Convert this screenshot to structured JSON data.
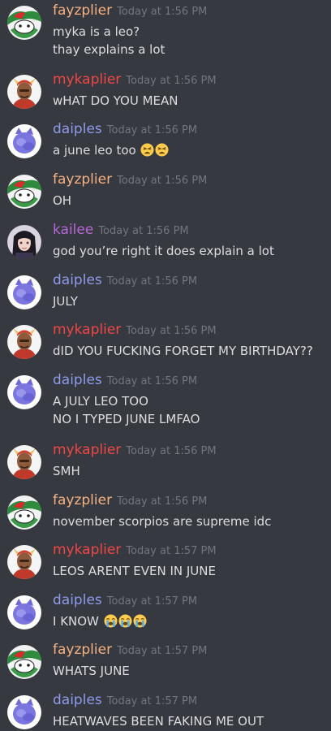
{
  "users": {
    "fayz": {
      "name": "fayzplier",
      "color": "#f4b183",
      "avatar_icon": "mouse-cap-avatar-icon"
    },
    "myka": {
      "name": "mykaplier",
      "color": "#f04747",
      "avatar_icon": "horned-man-avatar-icon"
    },
    "dai": {
      "name": "daiples",
      "color": "#8e9bea",
      "avatar_icon": "purple-cat-avatar-icon"
    },
    "kai": {
      "name": "kailee",
      "color": "#b768d8",
      "avatar_icon": "dark-hair-girl-avatar-icon"
    }
  },
  "messages": [
    {
      "user": "fayz",
      "timestamp": "Today at 1:56 PM",
      "lines": [
        "myka is a leo?",
        "thay explains a lot"
      ],
      "emoji": []
    },
    {
      "user": "myka",
      "timestamp": "Today at 1:56 PM",
      "lines": [
        "wHAT DO YOU MEAN"
      ],
      "emoji": []
    },
    {
      "user": "dai",
      "timestamp": "Today at 1:56 PM",
      "lines": [
        "a june leo too"
      ],
      "emoji": [
        "tired-face-emoji",
        "tired-face-emoji"
      ]
    },
    {
      "user": "fayz",
      "timestamp": "Today at 1:56 PM",
      "lines": [
        "OH"
      ],
      "emoji": []
    },
    {
      "user": "kai",
      "timestamp": "Today at 1:56 PM",
      "lines": [
        "god you’re right it does explain a lot"
      ],
      "emoji": []
    },
    {
      "user": "dai",
      "timestamp": "Today at 1:56 PM",
      "lines": [
        "JULY"
      ],
      "emoji": []
    },
    {
      "user": "myka",
      "timestamp": "Today at 1:56 PM",
      "lines": [
        "dID YOU FUCKING FORGET MY BIRTHDAY??"
      ],
      "emoji": []
    },
    {
      "user": "dai",
      "timestamp": "Today at 1:56 PM",
      "lines": [
        "A JULY LEO TOO",
        "NO I TYPED JUNE LMFAO"
      ],
      "emoji": []
    },
    {
      "user": "myka",
      "timestamp": "Today at 1:56 PM",
      "lines": [
        "SMH"
      ],
      "emoji": []
    },
    {
      "user": "fayz",
      "timestamp": "Today at 1:56 PM",
      "lines": [
        "november scorpios are supreme idc"
      ],
      "emoji": []
    },
    {
      "user": "myka",
      "timestamp": "Today at 1:57 PM",
      "lines": [
        "LEOS ARENT EVEN IN JUNE"
      ],
      "emoji": []
    },
    {
      "user": "dai",
      "timestamp": "Today at 1:57 PM",
      "lines": [
        "I KNOW"
      ],
      "emoji": [
        "loudly-crying-face-emoji",
        "loudly-crying-face-emoji",
        "loudly-crying-face-emoji"
      ]
    },
    {
      "user": "fayz",
      "timestamp": "Today at 1:57 PM",
      "lines": [
        "WHATS JUNE"
      ],
      "emoji": []
    },
    {
      "user": "dai",
      "timestamp": "Today at 1:57 PM",
      "lines": [
        "HEATWAVES BEEN FAKING ME OUT"
      ],
      "emoji": []
    }
  ]
}
